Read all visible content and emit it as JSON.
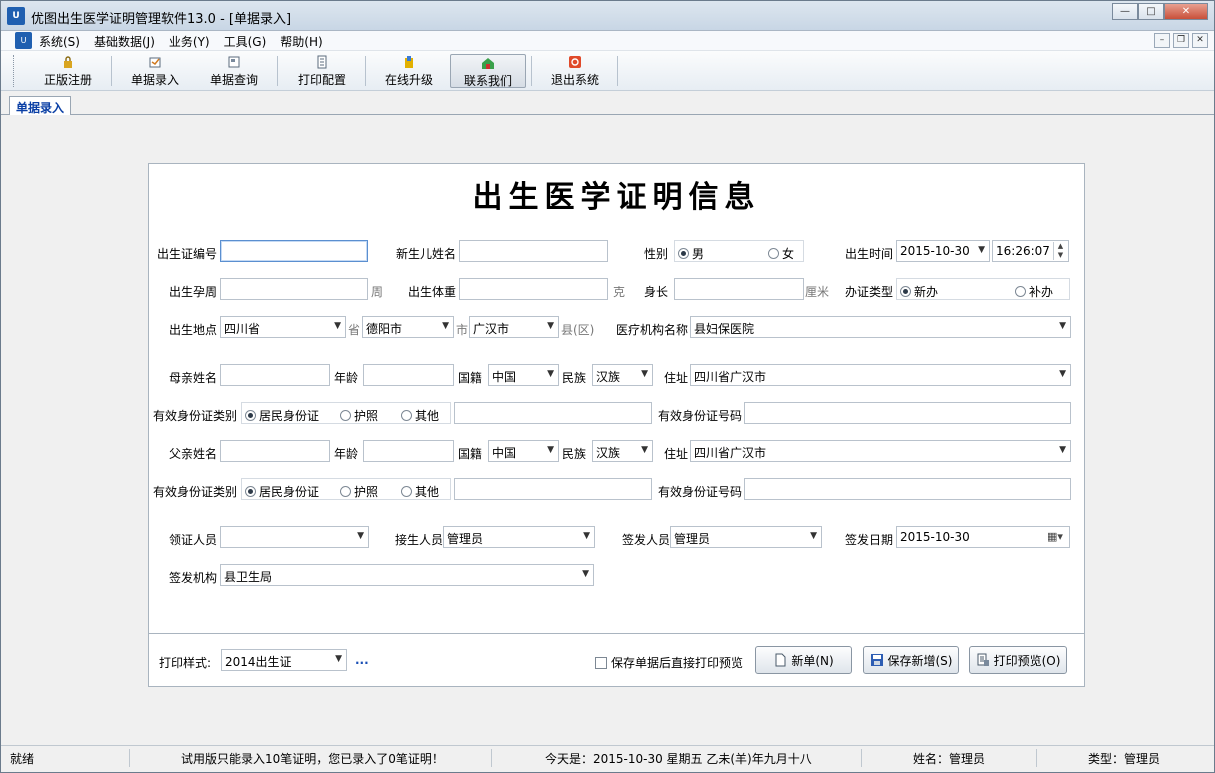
{
  "window": {
    "title": "优图出生医学证明管理软件13.0 - [单据录入]",
    "logo": "U"
  },
  "menu": {
    "items": [
      "系统(S)",
      "基础数据(J)",
      "业务(Y)",
      "工具(G)",
      "帮助(H)"
    ]
  },
  "toolbar": {
    "items": [
      "正版注册",
      "单据录入",
      "单据查询",
      "打印配置",
      "在线升级",
      "联系我们",
      "退出系统"
    ]
  },
  "tab": {
    "label": "单据录入"
  },
  "form": {
    "title": "出生医学证明信息",
    "labels": {
      "cert_no": "出生证编号",
      "baby_name": "新生儿姓名",
      "gender": "性别",
      "birth_time": "出生时间",
      "gest_week": "出生孕周",
      "weight": "出生体重",
      "height": "身长",
      "cert_type": "办证类型",
      "birth_place": "出生地点",
      "hospital": "医疗机构名称",
      "mother_name": "母亲姓名",
      "age": "年龄",
      "nationality": "国籍",
      "ethnic": "民族",
      "address": "住址",
      "id_type": "有效身份证类别",
      "id_no": "有效身份证号码",
      "father_name": "父亲姓名",
      "receiver": "领证人员",
      "acceptor": "接生人员",
      "signer": "签发人员",
      "sign_date": "签发日期",
      "sign_org": "签发机构"
    },
    "units": {
      "week": "周",
      "gram": "克",
      "cm": "厘米",
      "province": "省",
      "city": "市",
      "county": "县(区)"
    },
    "gender": {
      "male": "男",
      "female": "女",
      "selected": "男"
    },
    "birth_date": "2015-10-30",
    "birth_clock": "16:26:07",
    "cert_type": {
      "new": "新办",
      "supplement": "补办",
      "selected": "新办"
    },
    "province": "四川省",
    "city": "德阳市",
    "county": "广汉市",
    "hospital": "县妇保医院",
    "mother": {
      "nationality": "中国",
      "ethnic": "汉族",
      "address": "四川省广汉市"
    },
    "father": {
      "nationality": "中国",
      "ethnic": "汉族",
      "address": "四川省广汉市"
    },
    "id_options": {
      "resident": "居民身份证",
      "passport": "护照",
      "other": "其他",
      "selected": "居民身份证"
    },
    "acceptor": "管理员",
    "signer": "管理员",
    "sign_date": "2015-10-30",
    "sign_org": "县卫生局"
  },
  "footer": {
    "print_style_label": "打印样式:",
    "print_style": "2014出生证",
    "more": "...",
    "checkbox_label": "保存单据后直接打印预览",
    "btn_new": "新单(N)",
    "btn_save": "保存新增(S)",
    "btn_preview": "打印预览(O)"
  },
  "status": {
    "ready": "就绪",
    "trial": "试用版只能录入10笔证明，您已录入了0笔证明！",
    "today": "今天是：2015-10-30 星期五 乙未(羊)年九月十八",
    "user": "姓名：管理员",
    "role": "类型：管理员"
  }
}
